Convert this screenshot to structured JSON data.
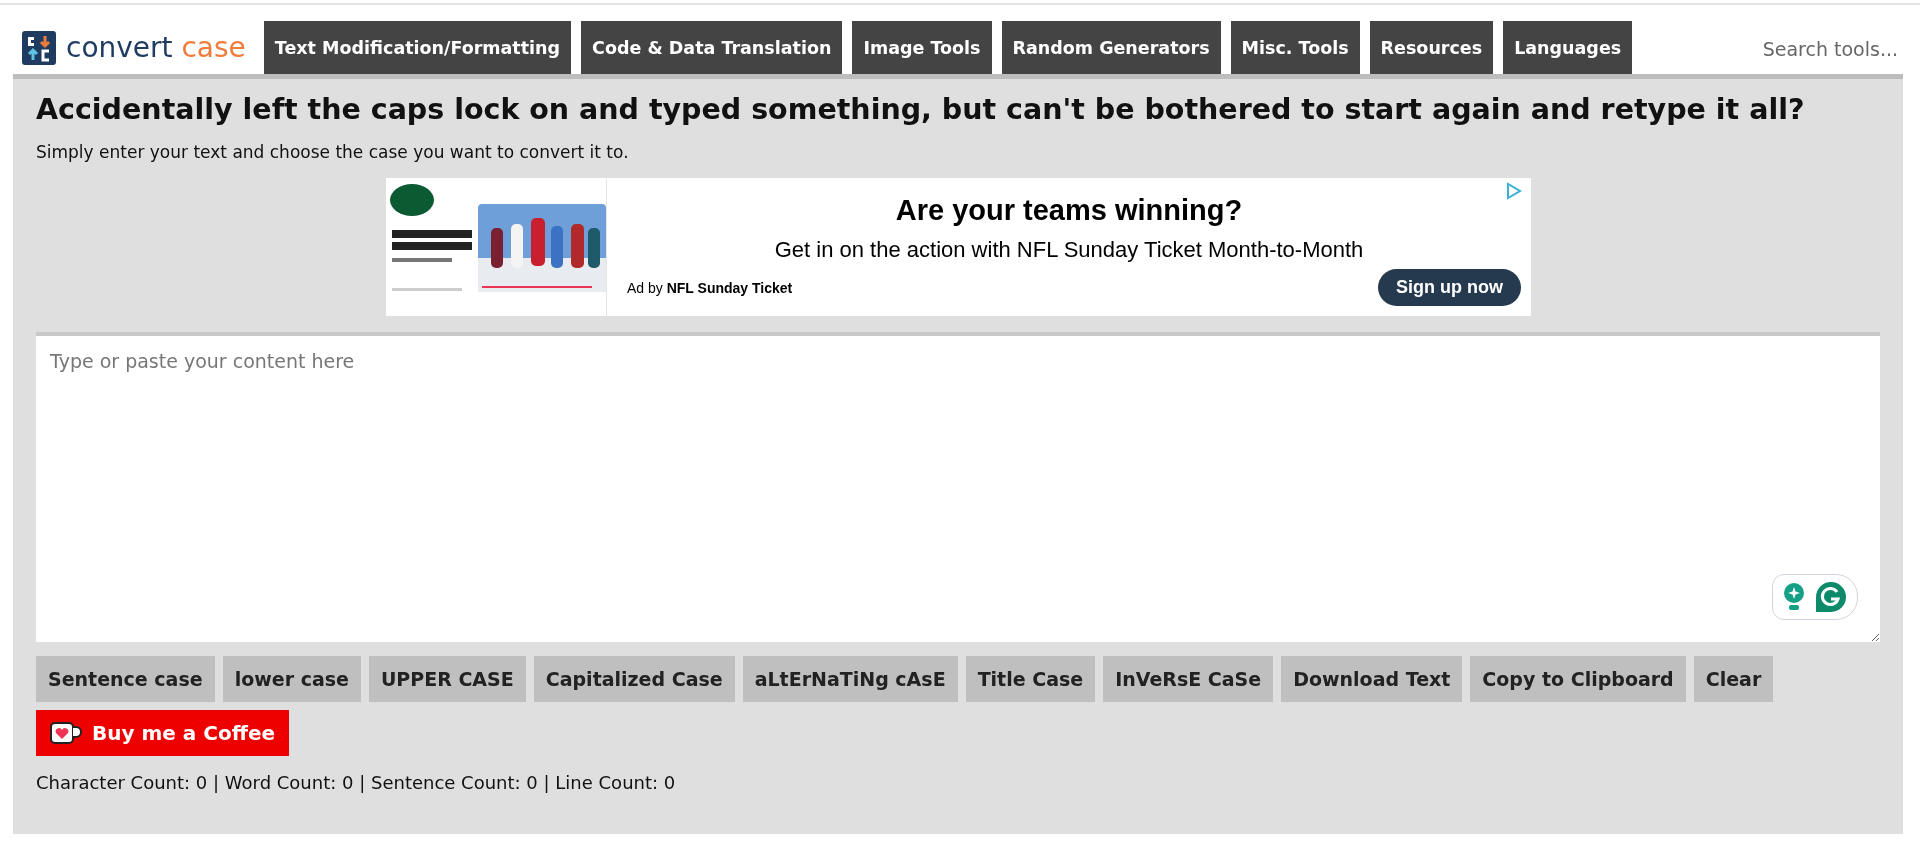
{
  "header": {
    "logo": {
      "word_1": "convert",
      "word_2": "case"
    },
    "nav": [
      {
        "label": "Text Modification/Formatting"
      },
      {
        "label": "Code & Data Translation"
      },
      {
        "label": "Image Tools"
      },
      {
        "label": "Random Generators"
      },
      {
        "label": "Misc. Tools"
      },
      {
        "label": "Resources"
      },
      {
        "label": "Languages"
      }
    ],
    "search": {
      "placeholder": "Search tools..."
    }
  },
  "main": {
    "title": "Accidentally left the caps lock on and typed something, but can't be bothered to start again and retype it all?",
    "subtitle": "Simply enter your text and choose the case you want to convert it to.",
    "ad": {
      "headline": "Are your teams winning?",
      "body": "Get in on the action with NFL Sunday Ticket Month-to-Month",
      "byline": "Ad by **NFL Sunday Ticket**",
      "cta": "Sign up now"
    },
    "editor": {
      "placeholder": "Type or paste your content here"
    },
    "buttons": [
      "Sentence case",
      "lower case",
      "UPPER CASE",
      "Capitalized Case",
      "aLtErNaTiNg cAsE",
      "Title Case",
      "InVeRsE CaSe",
      "Download Text",
      "Copy to Clipboard",
      "Clear"
    ],
    "coffee": {
      "label": "Buy me a Coffee"
    },
    "counts": "Character Count: 0 | Word Count: 0 | Sentence Count: 0 | Line Count: 0"
  }
}
